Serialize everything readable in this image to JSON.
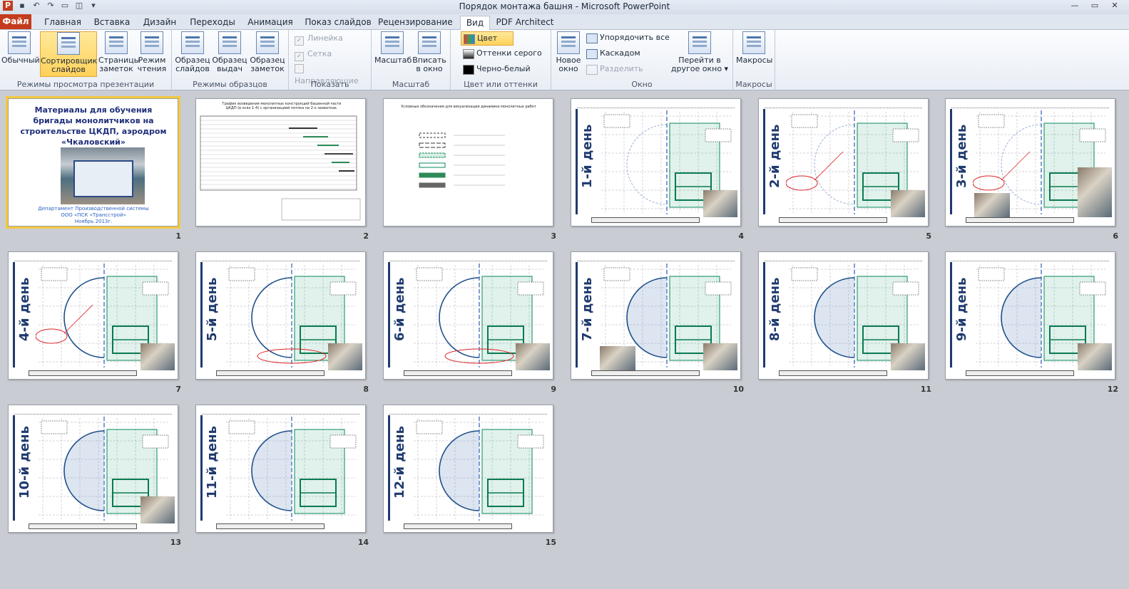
{
  "window": {
    "title": "Порядок монтажа башня - Microsoft PowerPoint"
  },
  "tabs": [
    "Файл",
    "Главная",
    "Вставка",
    "Дизайн",
    "Переходы",
    "Анимация",
    "Показ слайдов",
    "Рецензирование",
    "Вид",
    "PDF Architect"
  ],
  "active_tab": "Вид",
  "ribbon": {
    "presentation_views": {
      "label": "Режимы просмотра презентации",
      "normal": "Обычный",
      "sorter_l1": "Сортировщик",
      "sorter_l2": "слайдов",
      "notes_l1": "Страницы",
      "notes_l2": "заметок",
      "reading_l1": "Режим",
      "reading_l2": "чтения"
    },
    "master_views": {
      "label": "Режимы образцов",
      "slide_master_l1": "Образец",
      "slide_master_l2": "слайдов",
      "handout_master_l1": "Образец",
      "handout_master_l2": "выдач",
      "notes_master_l1": "Образец",
      "notes_master_l2": "заметок"
    },
    "show": {
      "label": "Показать",
      "ruler": "Линейка",
      "gridlines": "Сетка",
      "guides": "Направляющие"
    },
    "zoom": {
      "label": "Масштаб",
      "zoom": "Масштаб",
      "fit_l1": "Вписать",
      "fit_l2": "в окно"
    },
    "color": {
      "label": "Цвет или оттенки серого",
      "color": "Цвет",
      "grayscale": "Оттенки серого",
      "bw": "Черно-белый"
    },
    "window": {
      "label": "Окно",
      "new_l1": "Новое",
      "new_l2": "окно",
      "arrange_all": "Упорядочить все",
      "cascade": "Каскадом",
      "split": "Разделить",
      "switch_l1": "Перейти в",
      "switch_l2": "другое окно"
    },
    "macros": {
      "label": "Макросы",
      "macros": "Макросы"
    }
  },
  "slides": [
    {
      "num": "1",
      "kind": "cover",
      "title_lines": [
        "Материалы  для обучения",
        "бригады монолитчиков  на",
        "строительстве  ЦКДП, аэродром",
        "«Чкаловский»"
      ],
      "footer_lines": [
        "Департамент  Производственной системы",
        "ООО «ПСК «Трансстрой»",
        "Ноябрь 2013г."
      ]
    },
    {
      "num": "2",
      "kind": "gantt",
      "title": "График возведения монолитных конструкций башенной части ЦКДП (в осях 1-4) с организацией потока на 2-х захватках."
    },
    {
      "num": "3",
      "kind": "legend",
      "title": "Условные обозначения для визуализации динамики монолитных работ"
    },
    {
      "num": "4",
      "kind": "day",
      "day": "1-й день"
    },
    {
      "num": "5",
      "kind": "day",
      "day": "2-й день"
    },
    {
      "num": "6",
      "kind": "day",
      "day": "3-й день"
    },
    {
      "num": "7",
      "kind": "day",
      "day": "4-й день"
    },
    {
      "num": "8",
      "kind": "day",
      "day": "5-й день"
    },
    {
      "num": "9",
      "kind": "day",
      "day": "6-й день"
    },
    {
      "num": "10",
      "kind": "day",
      "day": "7-й день"
    },
    {
      "num": "11",
      "kind": "day",
      "day": "8-й день"
    },
    {
      "num": "12",
      "kind": "day",
      "day": "9-й день"
    },
    {
      "num": "13",
      "kind": "day",
      "day": "10-й день"
    },
    {
      "num": "14",
      "kind": "day",
      "day": "11-й день"
    },
    {
      "num": "15",
      "kind": "day",
      "day": "12-й день"
    }
  ]
}
